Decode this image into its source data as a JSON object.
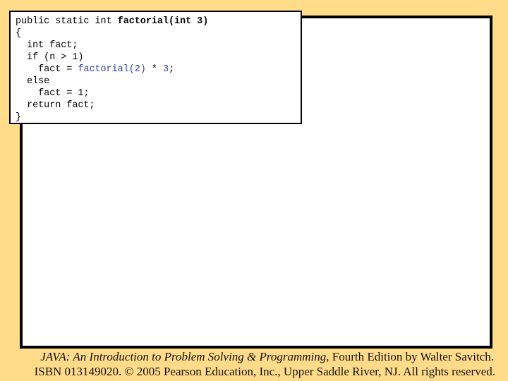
{
  "slide": {
    "background_color": "#FFDB8A",
    "code_lines": [
      {
        "indent": "",
        "segments": [
          {
            "text": "public static int ",
            "style": "normal"
          },
          {
            "text": "factorial(int 3)",
            "style": "bold"
          }
        ]
      },
      {
        "indent": "",
        "segments": [
          {
            "text": "{",
            "style": "normal"
          }
        ]
      },
      {
        "indent": "  ",
        "segments": [
          {
            "text": "int fact;",
            "style": "normal"
          }
        ]
      },
      {
        "indent": "  ",
        "segments": [
          {
            "text": "if (n > 1)",
            "style": "normal"
          }
        ]
      },
      {
        "indent": "    ",
        "segments": [
          {
            "text": "fact = ",
            "style": "normal"
          },
          {
            "text": "factorial(2)",
            "style": "blue"
          },
          {
            "text": " * ",
            "style": "normal"
          },
          {
            "text": "3",
            "style": "blue"
          },
          {
            "text": ";",
            "style": "normal"
          }
        ]
      },
      {
        "indent": "  ",
        "segments": [
          {
            "text": "else",
            "style": "normal"
          }
        ]
      },
      {
        "indent": "    ",
        "segments": [
          {
            "text": "fact = 1;",
            "style": "normal"
          }
        ]
      },
      {
        "indent": "  ",
        "segments": [
          {
            "text": "return fact;",
            "style": "normal"
          }
        ]
      },
      {
        "indent": "",
        "segments": [
          {
            "text": "}",
            "style": "normal"
          }
        ]
      }
    ],
    "highlight_color": "#2a3f9a"
  },
  "footer": {
    "line1_title": "JAVA: An Introduction to Problem Solving & Programming",
    "line1_rest": ", Fourth Edition by Walter Savitch.",
    "line2": "ISBN 013149020. © 2005 Pearson Education, Inc., Upper Saddle River, NJ. All rights reserved."
  }
}
